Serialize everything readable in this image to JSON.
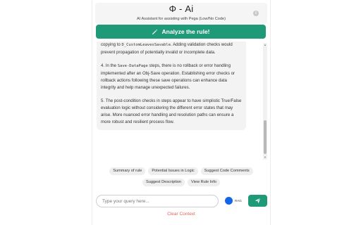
{
  "header": {
    "title": "Φ - Ai",
    "subtitle": "AI Assistant for assisting with Pega (Low/No Code)",
    "info_icon": "i"
  },
  "analyze_button": {
    "label": "Analyze the rule!",
    "icon": "pencil-icon"
  },
  "message": {
    "p1_prefix": "copying to ",
    "p1_code": "D_CustomLeavesSavable",
    "p1_suffix": ". Adding validation checks would prevent propagation of potentially invalid or incomplete data.",
    "p2_prefix": "4. In the ",
    "p2_code": "Save-DataPage",
    "p2_suffix": " steps, there is no rollback or error handling implemented after an Obj-Save operation. Establishing error checks or rollback actions following these save operations can enhance data integrity and help manage unexpected failures.",
    "p3": "5. The post-condition checks in steps appear to have simplistic True/False evaluation logic without considering the different error states that may arise. More nuanced error handling and resolution paths can ensure a more robust and resilient process flow."
  },
  "suggestions": {
    "row1": [
      "Summary of rule",
      "Potential Issues in Logic",
      "Suggest Code Comments"
    ],
    "row2": [
      "Suggest Description",
      "View Rule Info"
    ]
  },
  "input": {
    "placeholder": "Type your query here...",
    "value": ""
  },
  "rag": {
    "label": "RAG",
    "color": "#1565e8"
  },
  "send_button": {
    "icon": "send-icon"
  },
  "clear_context": {
    "label": "Clear Context"
  },
  "colors": {
    "accent": "#1f9a78",
    "danger_text": "#e0645a"
  }
}
